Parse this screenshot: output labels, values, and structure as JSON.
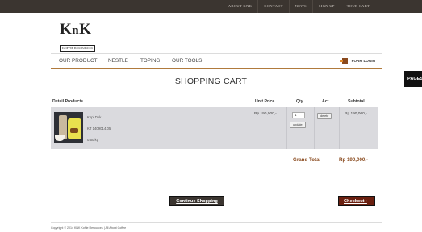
{
  "top_nav": [
    "ABOUT KNK",
    "CONTACT",
    "NEWS",
    "SIGN UP",
    "TOUR CART"
  ],
  "logo": {
    "main": "K",
    "middle": "n",
    "end": "K",
    "tagline": "KOFFIE RESOURCES"
  },
  "main_nav": [
    "OUR PRODUCT",
    "NESTLE",
    "TOPING",
    "OUR TOOLS"
  ],
  "login_label": "FORM LOGIN",
  "side_tab": "PAGES",
  "page_title": "SHOPPING CART",
  "table_headers": {
    "product": "Detail Products",
    "unit_price": "Unit Price",
    "qty": "Qty",
    "act": "Act",
    "subtotal": "Subtotal"
  },
  "cart_items": [
    {
      "name": "Kopi Duk",
      "code": "KT 1409014.05",
      "weight": "0.50 kg",
      "unit_price": "Rp 190,000,-",
      "qty": "1",
      "update_label": "update",
      "delete_label": "delete",
      "subtotal": "Rp 190,000,-"
    }
  ],
  "grand_total": {
    "label": "Grand Total",
    "value": "Rp 190,000,-"
  },
  "buttons": {
    "continue": "Continue Shopping",
    "checkout": "Checkout ›"
  },
  "footer": "Copyright © 2014 KNK Koffie Resources | All About Coffee",
  "colors": {
    "top_bar": "#3b3530",
    "accent": "#8a4a1e",
    "checkout": "#6a1f0f"
  }
}
